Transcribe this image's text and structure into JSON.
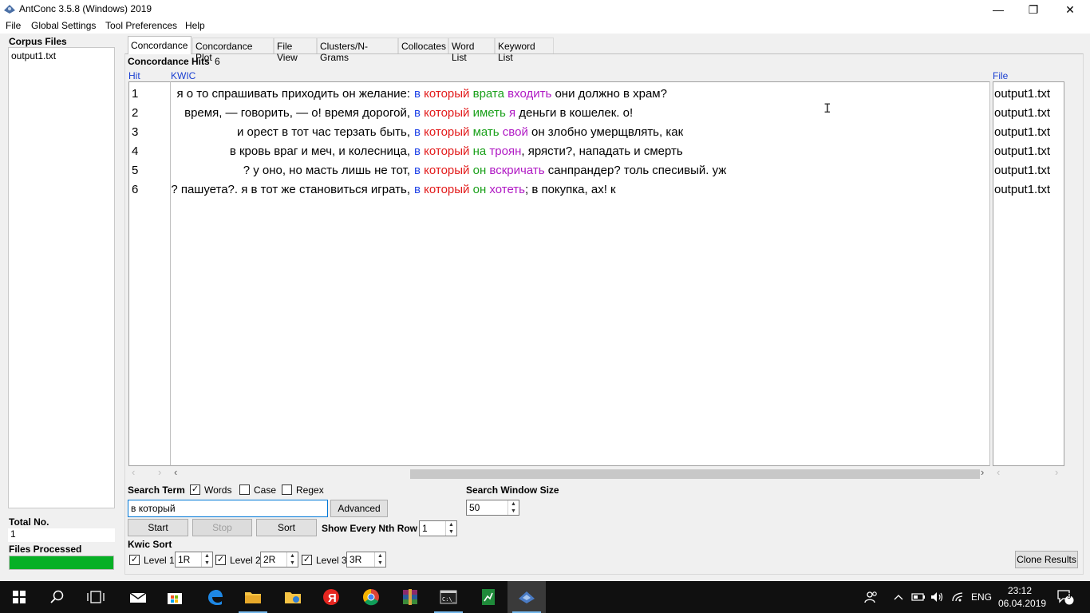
{
  "window": {
    "title": "AntConc 3.5.8 (Windows) 2019",
    "minimize_glyph": "—",
    "maximize_glyph": "❐",
    "close_glyph": "✕"
  },
  "menu": [
    "File",
    "Global Settings",
    "Tool Preferences",
    "Help"
  ],
  "left_panel": {
    "corpus_files_title": "Corpus Files",
    "files": [
      "output1.txt"
    ],
    "total_no_label": "Total No.",
    "total_no_value": "1",
    "files_processed_label": "Files Processed",
    "files_processed_fraction": 1.0
  },
  "tabs": [
    "Concordance",
    "Concordance Plot",
    "File View",
    "Clusters/N-Grams",
    "Collocates",
    "Word List",
    "Keyword List"
  ],
  "active_tab": "Concordance",
  "concordance": {
    "hits_label": "Concordance Hits",
    "hits_count": "6",
    "col_hit": "Hit",
    "col_kwic": "KWIC",
    "col_file": "File",
    "rows": [
      {
        "hit": "1",
        "left": "я о то спрашивать приходить он желание:",
        "w1": "в",
        "w2": "который",
        "w3": "врата",
        "w4": "входить",
        "rest": " они должно в храм?",
        "file": "output1.txt"
      },
      {
        "hit": "2",
        "left": "время, — говорить, — о! время дорогой,",
        "w1": "в",
        "w2": "который",
        "w3": "иметь",
        "w4": "я",
        "rest": " деньги в кошелек. о!",
        "file": "output1.txt"
      },
      {
        "hit": "3",
        "left": "и орест в тот час терзать быть,",
        "w1": "в",
        "w2": "который",
        "w3": "мать",
        "w4": "свой",
        "rest": " он злобно умерщвлять, как",
        "file": "output1.txt"
      },
      {
        "hit": "4",
        "left": "в кровь враг и меч, и колесница,",
        "w1": "в",
        "w2": "который",
        "w3": "на",
        "w4": "троян",
        "rest": ", ярясти?, нападать и смерть",
        "file": "output1.txt"
      },
      {
        "hit": "5",
        "left": "? у оно, но масть лишь не тот,",
        "w1": "в",
        "w2": "который",
        "w3": "он",
        "w4": "вскричать",
        "rest": " санпрандер? толь спесивый. уж",
        "file": "output1.txt"
      },
      {
        "hit": "6",
        "left": "? пашуета?. я в тот же становиться играть,",
        "w1": "в",
        "w2": "который",
        "w3": "он",
        "w4": "хотеть",
        "rest": "; в покупка, ах! к",
        "file": "output1.txt"
      }
    ]
  },
  "search": {
    "term_label": "Search Term",
    "words_label": "Words",
    "words_checked": true,
    "case_label": "Case",
    "case_checked": false,
    "regex_label": "Regex",
    "regex_checked": false,
    "term_value": "в который",
    "advanced_label": "Advanced",
    "start_label": "Start",
    "stop_label": "Stop",
    "sort_label": "Sort",
    "window_size_label": "Search Window Size",
    "window_size_value": "50",
    "nth_row_label": "Show Every Nth Row",
    "nth_row_value": "1"
  },
  "kwic_sort": {
    "label": "Kwic Sort",
    "levels": [
      {
        "label": "Level 1",
        "value": "1R",
        "checked": true
      },
      {
        "label": "Level 2",
        "value": "2R",
        "checked": true
      },
      {
        "label": "Level 3",
        "value": "3R",
        "checked": true
      }
    ],
    "clone_results_label": "Clone Results"
  },
  "taskbar": {
    "language": "ENG",
    "time": "23:12",
    "date": "06.04.2019",
    "notifications": "9"
  }
}
